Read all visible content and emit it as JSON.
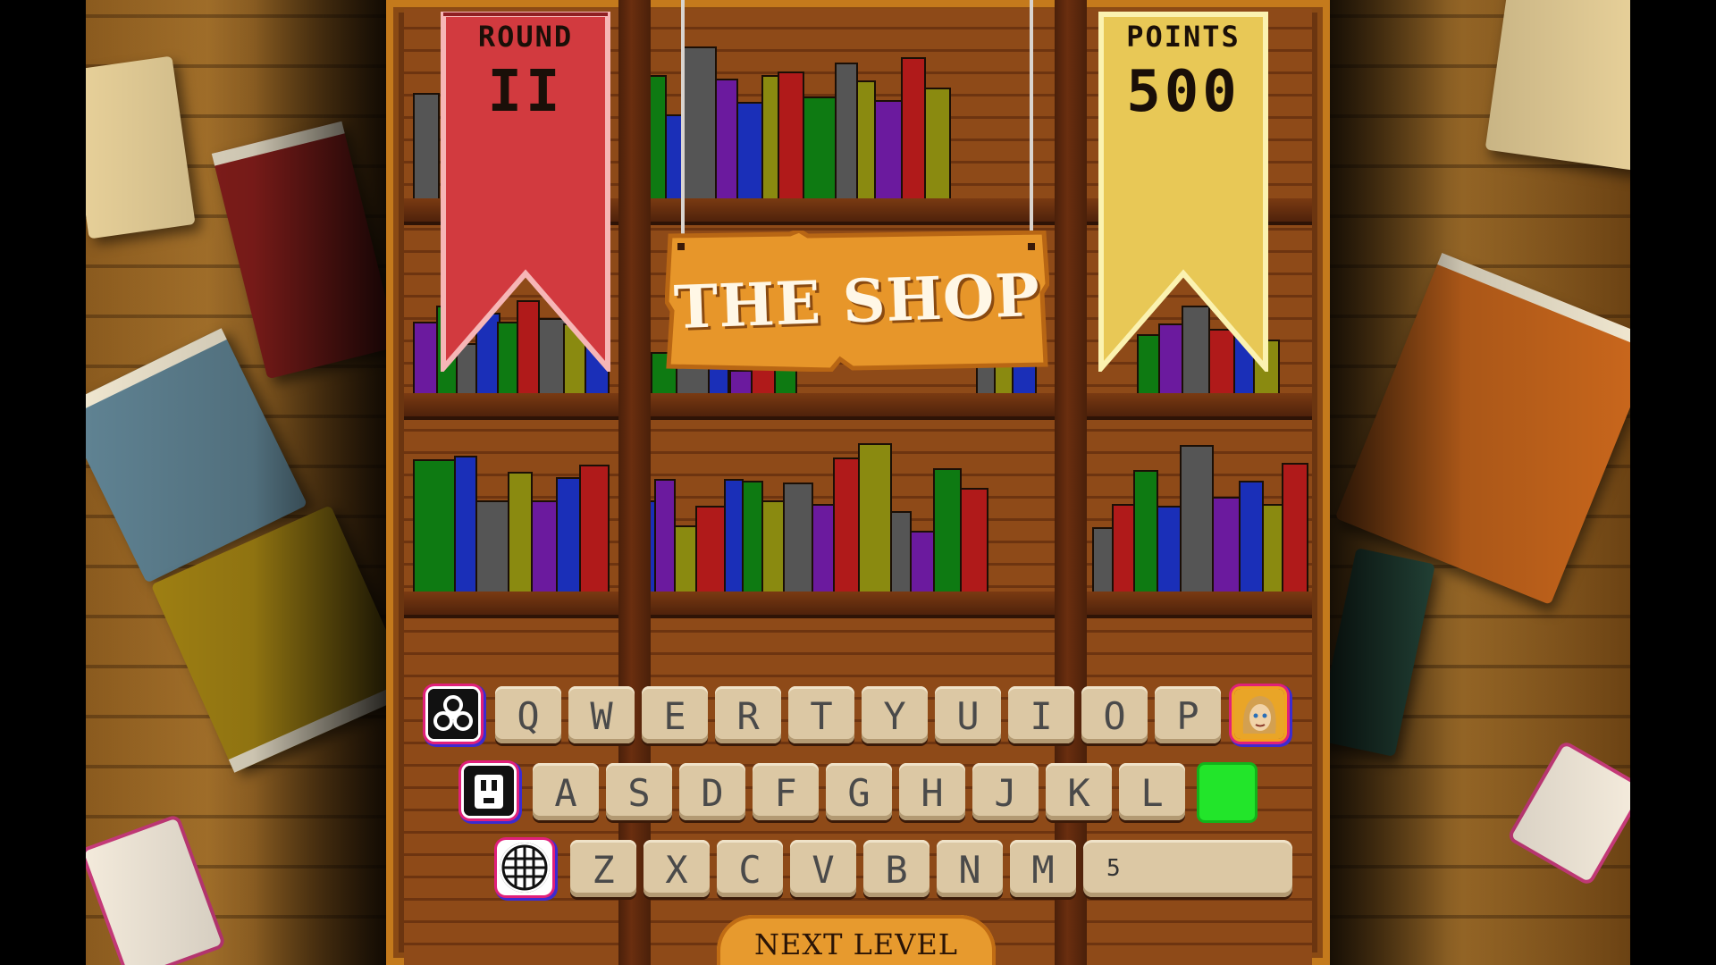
{
  "hud": {
    "round_label": "ROUND",
    "round_value": "II",
    "points_label": "POINTS",
    "points_value": "500"
  },
  "shop": {
    "title": "THE SHOP"
  },
  "keyboard": {
    "row1": [
      "Q",
      "W",
      "E",
      "R",
      "T",
      "Y",
      "U",
      "I",
      "O",
      "P"
    ],
    "row2": [
      "A",
      "S",
      "D",
      "F",
      "G",
      "H",
      "J",
      "K",
      "L"
    ],
    "row3": [
      "Z",
      "X",
      "C",
      "V",
      "B",
      "N",
      "M"
    ],
    "counter_value": "5"
  },
  "actions": {
    "next_level_label": "NEXT LEVEL"
  },
  "colors": {
    "round_banner": "#d23a3f",
    "points_banner": "#e8c856",
    "shop_sign": "#e7962a",
    "key_face": "#dcc8a4",
    "green_slot": "#22e52a"
  }
}
